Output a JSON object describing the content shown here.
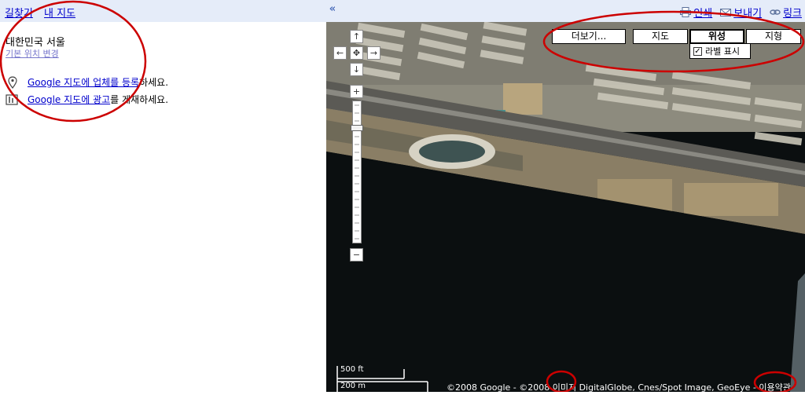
{
  "topbar": {
    "directions": "길찾기",
    "my_maps": "내 지도",
    "print": "인쇄",
    "send": "보내기",
    "link": "링크"
  },
  "left_panel": {
    "location_name": "대한민국 서울",
    "change_default_location": "기본 위치 변경",
    "promo_business_link": "Google 지도에 업체를 등록",
    "promo_business_suffix": "하세요.",
    "promo_ads_link": "Google 지도에 광고",
    "promo_ads_suffix": "를 게재하세요."
  },
  "map_controls": {
    "pan_up": "↑",
    "pan_left": "←",
    "pan_center": "✥",
    "pan_right": "→",
    "pan_down": "↓",
    "zoom_in": "+",
    "zoom_out": "−",
    "zoom_level_fraction": 0.18
  },
  "map_types": {
    "more": "더보기...",
    "map": "지도",
    "satellite": "위성",
    "terrain": "지형",
    "active": "satellite",
    "show_labels": "라벨 표시",
    "show_labels_checked": true
  },
  "scale": {
    "imperial": "500 ft",
    "metric": "200 m"
  },
  "attribution": "©2008 Google - ©2008 이미지 DigitalGlobe, Cnes/Spot Image, GeoEye - 이용약관",
  "colors": {
    "topbar_bg": "#e5ecf9",
    "link": "#0000cc",
    "annotation": "#cc0000",
    "water": "#0b0f10"
  },
  "icons": {
    "collapse": "double-chevron-left-icon",
    "print": "printer-icon",
    "send": "envelope-icon",
    "link": "chain-link-icon",
    "business": "map-pin-icon",
    "ads": "ads-icon"
  }
}
